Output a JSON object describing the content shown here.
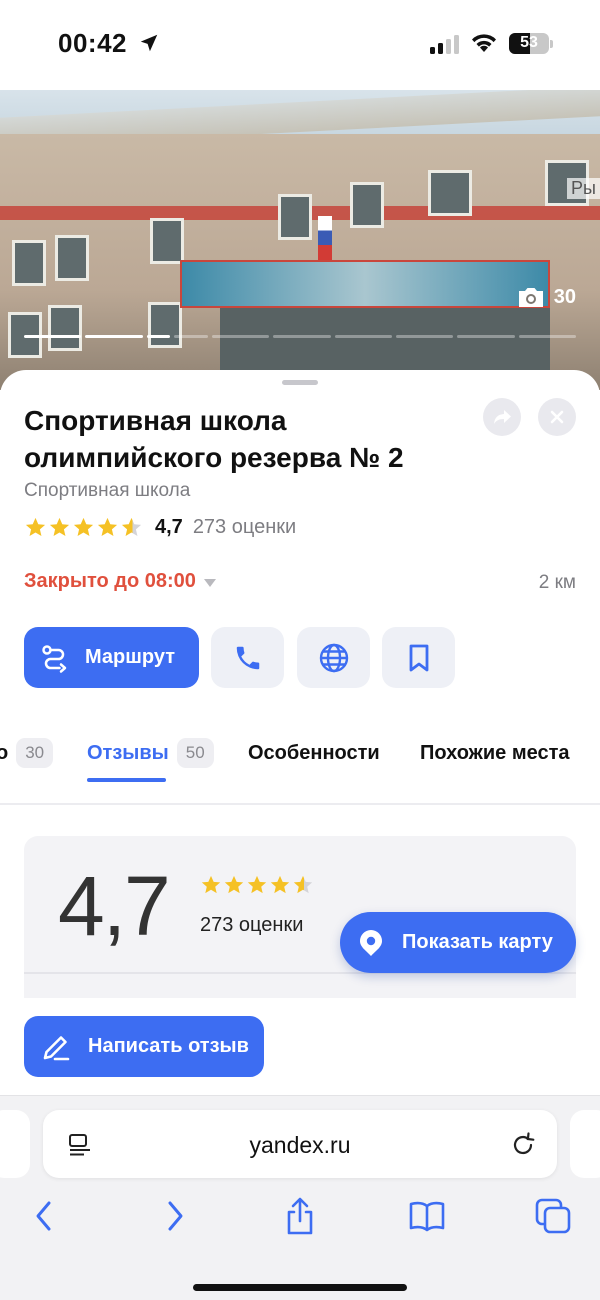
{
  "status_bar": {
    "time": "00:42",
    "battery": "53"
  },
  "photo": {
    "count": "30",
    "map_label_fragment": "Ры"
  },
  "place": {
    "title": "Спортивная школа олимпийского резерва № 2",
    "category": "Спортивная школа",
    "rating": "4,7",
    "rating_count": "273 оценки",
    "stars_filled": 4.5,
    "hours": "Закрыто до 08:00",
    "distance": "2 км"
  },
  "actions": {
    "route_label": "Маршрут"
  },
  "tabs": [
    {
      "label": "о",
      "badge": "30"
    },
    {
      "label": "Отзывы",
      "badge": "50"
    },
    {
      "label": "Особенности"
    },
    {
      "label": "Похожие места"
    }
  ],
  "reviews": {
    "rating": "4,7",
    "rating_count": "273 оценки",
    "show_map_label": "Показать карту",
    "write_review_label": "Написать отзыв"
  },
  "browser": {
    "url": "yandex.ru"
  },
  "colors": {
    "accent": "#3d6df2",
    "closed": "#e0503d",
    "star": "#f5c125"
  },
  "icons": [
    "location-arrow-icon",
    "signal-icon",
    "wifi-icon",
    "battery-icon",
    "camera-icon",
    "share-icon",
    "close-icon",
    "route-icon",
    "phone-icon",
    "globe-icon",
    "bookmark-icon",
    "star-icon",
    "map-pin-icon",
    "pencil-icon",
    "page-menu-icon",
    "reload-icon",
    "back-icon",
    "forward-icon",
    "share-sheet-icon",
    "book-icon",
    "tabs-icon"
  ]
}
